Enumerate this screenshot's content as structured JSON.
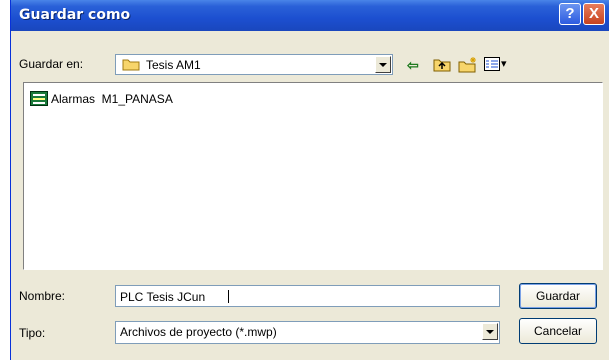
{
  "window": {
    "title": "Guardar como",
    "help_glyph": "?",
    "close_glyph": "X"
  },
  "save_in": {
    "label": "Guardar en:",
    "value": "Tesis AM1"
  },
  "toolbar": {
    "icons": [
      "back-arrow-icon",
      "up-folder-icon",
      "new-folder-icon",
      "view-menu-icon"
    ],
    "back_glyph": "⇦",
    "view_dropdown_glyph": "▾"
  },
  "files": [
    {
      "name": "Alarmas  M1_PANASA",
      "icon": "project-file-icon"
    }
  ],
  "name_field": {
    "label": "Nombre:",
    "value": "PLC Tesis JCun"
  },
  "type_field": {
    "label": "Tipo:",
    "value": "Archivos de proyecto (*.mwp)"
  },
  "buttons": {
    "save": "Guardar",
    "cancel": "Cancelar"
  },
  "colors": {
    "titlebar": "#1c4fd0",
    "dialog_bg": "#ece9d8",
    "field_border": "#7f9db9"
  }
}
